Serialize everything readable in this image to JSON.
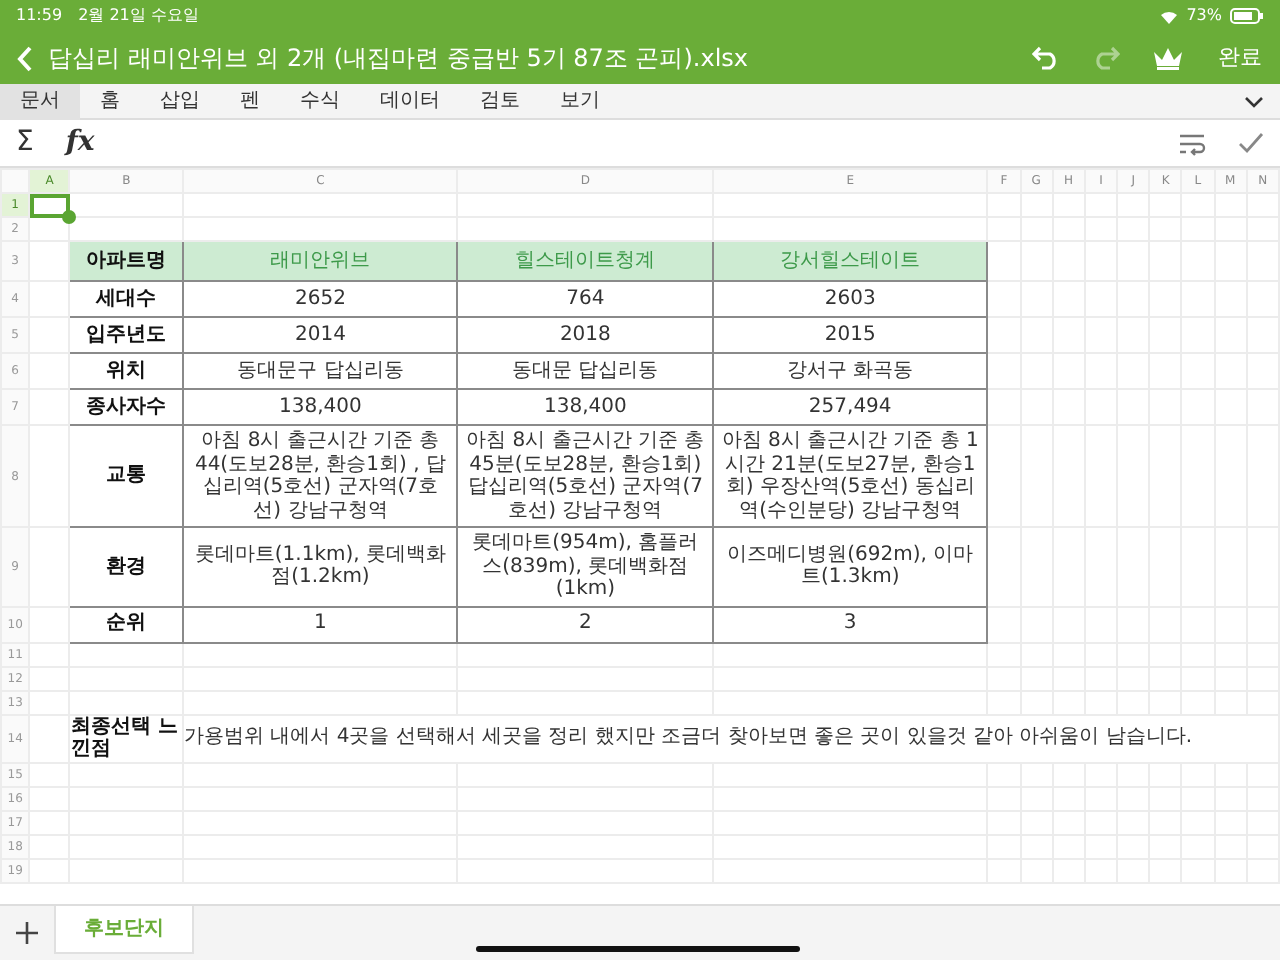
{
  "status_bar": {
    "time": "11:59",
    "date": "2월 21일 수요일",
    "battery": "73%"
  },
  "title_bar": {
    "title": "답십리 래미안위브 외 2개 (내집마련 중급반 5기 87조 곤피).xlsx",
    "redo": {
      "disabled": true
    },
    "done": "완료"
  },
  "menu_tabs": [
    {
      "label": "문서",
      "selected": true
    },
    {
      "label": "홈",
      "selected": false
    },
    {
      "label": "삽입",
      "selected": false
    },
    {
      "label": "펜",
      "selected": false
    },
    {
      "label": "수식",
      "selected": false
    },
    {
      "label": "데이터",
      "selected": false
    },
    {
      "label": "검토",
      "selected": false
    },
    {
      "label": "보기",
      "selected": false
    }
  ],
  "formula_bar": {
    "sum": "Σ",
    "function": "fx"
  },
  "columns": [
    {
      "label": "A",
      "selected": true
    },
    {
      "label": "B",
      "selected": false
    },
    {
      "label": "C",
      "selected": false
    },
    {
      "label": "D",
      "selected": false
    },
    {
      "label": "E",
      "selected": false
    },
    {
      "label": "F",
      "selected": false
    },
    {
      "label": "G",
      "selected": false
    },
    {
      "label": "H",
      "selected": false
    },
    {
      "label": "I",
      "selected": false
    },
    {
      "label": "J",
      "selected": false
    },
    {
      "label": "K",
      "selected": false
    },
    {
      "label": "L",
      "selected": false
    },
    {
      "label": "M",
      "selected": false
    },
    {
      "label": "N",
      "selected": false
    }
  ],
  "rows": [
    {
      "number": "1",
      "kind": "empty",
      "selected": true
    },
    {
      "number": "2",
      "kind": "empty",
      "selected": false
    },
    {
      "number": "3",
      "kind": "header",
      "selected": false,
      "label": "아파트명",
      "values": [
        "래미안위브",
        "힐스테이트청계",
        "강서힐스테이트"
      ]
    },
    {
      "number": "4",
      "kind": "data",
      "selected": false,
      "label": "세대수",
      "values": [
        "2652",
        "764",
        "2603"
      ]
    },
    {
      "number": "5",
      "kind": "data",
      "selected": false,
      "label": "입주년도",
      "values": [
        "2014",
        "2018",
        "2015"
      ]
    },
    {
      "number": "6",
      "kind": "data",
      "selected": false,
      "label": "위치",
      "values": [
        "동대문구 답십리동",
        "동대문 답십리동",
        "강서구 화곡동"
      ]
    },
    {
      "number": "7",
      "kind": "data",
      "selected": false,
      "label": "종사자수",
      "values": [
        "138,400",
        "138,400",
        "257,494"
      ]
    },
    {
      "number": "8",
      "kind": "data",
      "selected": false,
      "label": "교통",
      "values": [
        "아침 8시 출근시간 기준 총44(도보28분, 환승1회) , 답십리역(5호선) 군자역(7호선) 강남구청역",
        "아침 8시 출근시간 기준 총45분(도보28분, 환승1회) 답십리역(5호선) 군자역(7호선) 강남구청역",
        "아침 8시 출근시간 기준 총 1시간 21분(도보27분, 환승1회) 우장산역(5호선) 동십리역(수인분당) 강남구청역"
      ]
    },
    {
      "number": "9",
      "kind": "data",
      "selected": false,
      "label": "환경",
      "values": [
        "롯데마트(1.1km), 롯데백화점(1.2km)",
        "롯데마트(954m), 홈플러스(839m), 롯데백화점(1km)",
        "이즈메디병원(692m), 이마트(1.3km)"
      ]
    },
    {
      "number": "10",
      "kind": "data",
      "selected": false,
      "label": "순위",
      "values": [
        "1",
        "2",
        "3"
      ]
    },
    {
      "number": "11",
      "kind": "empty",
      "selected": false
    },
    {
      "number": "12",
      "kind": "empty",
      "selected": false
    },
    {
      "number": "13",
      "kind": "empty",
      "selected": false
    },
    {
      "number": "14",
      "kind": "note",
      "selected": false,
      "label": "최종선택 느낀점",
      "text": "가용범위 내에서 4곳을 선택해서 세곳을 정리 했지만 조금더 찾아보면 좋은 곳이 있을것 같아 아쉬움이 남습니다."
    },
    {
      "number": "15",
      "kind": "empty",
      "selected": false
    },
    {
      "number": "16",
      "kind": "empty",
      "selected": false
    },
    {
      "number": "17",
      "kind": "empty",
      "selected": false
    },
    {
      "number": "18",
      "kind": "empty",
      "selected": false
    },
    {
      "number": "19",
      "kind": "empty",
      "selected": false
    }
  ],
  "sheet_tabs": [
    {
      "label": "후보단지",
      "selected": true
    }
  ]
}
